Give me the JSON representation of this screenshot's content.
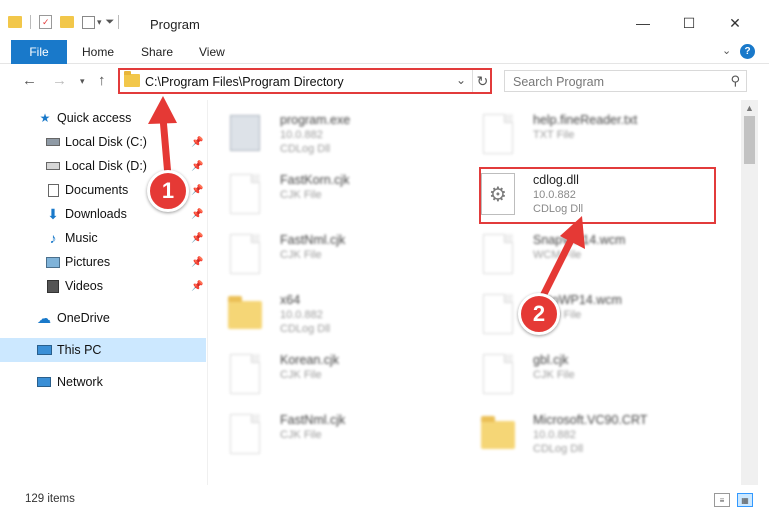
{
  "window": {
    "title": "Program"
  },
  "window_controls": {
    "minimize": "—",
    "maximize": "☐",
    "close": "✕"
  },
  "ribbon": {
    "file": "File",
    "home": "Home",
    "share": "Share",
    "view": "View",
    "help": "?"
  },
  "address": {
    "path": "C:\\Program Files\\Program Directory"
  },
  "search": {
    "placeholder": "Search Program"
  },
  "sidebar": {
    "items": [
      {
        "label": "Quick access",
        "icon": "star-icon"
      },
      {
        "label": "Local Disk (C:)",
        "icon": "drive-icon",
        "pinned": true
      },
      {
        "label": "Local Disk (D:)",
        "icon": "drive-icon",
        "pinned": true
      },
      {
        "label": "Documents",
        "icon": "documents-icon",
        "pinned": true
      },
      {
        "label": "Downloads",
        "icon": "download-icon",
        "pinned": true
      },
      {
        "label": "Music",
        "icon": "music-icon",
        "pinned": true
      },
      {
        "label": "Pictures",
        "icon": "pictures-icon",
        "pinned": true
      },
      {
        "label": "Videos",
        "icon": "videos-icon",
        "pinned": true
      },
      {
        "label": "OneDrive",
        "icon": "cloud-icon"
      },
      {
        "label": "This PC",
        "icon": "computer-icon",
        "selected": true
      },
      {
        "label": "Network",
        "icon": "network-icon"
      }
    ]
  },
  "files": {
    "left": [
      {
        "name": "program.exe",
        "line2": "10.0.882",
        "line3": "CDLog Dll",
        "type": "exe"
      },
      {
        "name": "FastKorn.cjk",
        "line2": "CJK File",
        "line3": "",
        "type": "doc"
      },
      {
        "name": "FastNml.cjk",
        "line2": "CJK File",
        "line3": "",
        "type": "doc"
      },
      {
        "name": "x64",
        "line2": "10.0.882",
        "line3": "CDLog Dll",
        "type": "folder"
      },
      {
        "name": "Korean.cjk",
        "line2": "CJK File",
        "line3": "",
        "type": "doc"
      },
      {
        "name": "FastNml.cjk",
        "line2": "CJK File",
        "line3": "",
        "type": "doc"
      }
    ],
    "right": [
      {
        "name": "help.fineReader.txt",
        "line2": "TXT File",
        "line3": "",
        "type": "doc"
      },
      {
        "name": "cdlog.dll",
        "line2": "10.0.882",
        "line3": "CDLog Dll",
        "type": "dll",
        "highlighted": true
      },
      {
        "name": "SnapWP14.wcm",
        "line2": "WCM File",
        "line3": "",
        "type": "doc"
      },
      {
        "name": "AutoWP14.wcm",
        "line2": "WCM File",
        "line3": "",
        "type": "doc"
      },
      {
        "name": "gbl.cjk",
        "line2": "CJK File",
        "line3": "",
        "type": "doc"
      },
      {
        "name": "Microsoft.VC90.CRT",
        "line2": "10.0.882",
        "line3": "CDLog Dll",
        "type": "folder"
      }
    ]
  },
  "status": {
    "count": "129 items"
  },
  "annotations": {
    "step1": "1",
    "step2": "2",
    "color": "#e53935"
  },
  "colors": {
    "accent": "#1979ca",
    "highlight": "#e23b3b",
    "selected": "#cce8ff"
  }
}
